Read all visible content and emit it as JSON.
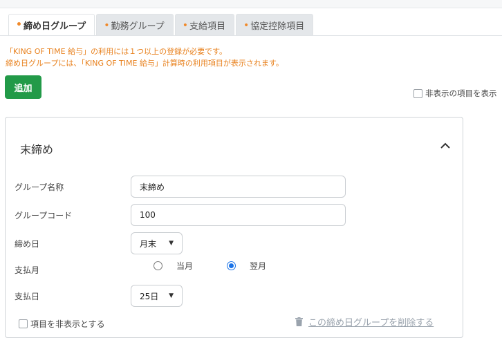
{
  "tabs": [
    {
      "label": "締め日グループ",
      "active": true
    },
    {
      "label": "勤務グループ",
      "active": false
    },
    {
      "label": "支給項目",
      "active": false
    },
    {
      "label": "協定控除項目",
      "active": false
    }
  ],
  "tab_dot": "•",
  "notice": {
    "line1": "「KING OF TIME 給与」の利用には１つ以上の登録が必要です。",
    "line2": "締め日グループには、「KING OF TIME 給与」計算時の利用項目が表示されます。"
  },
  "add_button": "追加",
  "show_hidden_label": "非表示の項目を表示",
  "card": {
    "title": "末締め",
    "fields": {
      "group_name": {
        "label": "グループ名称",
        "value": "末締め"
      },
      "group_code": {
        "label": "グループコード",
        "value": "100"
      },
      "closing_day": {
        "label": "締め日",
        "value": "月末"
      },
      "payment_month": {
        "label": "支払月",
        "options": [
          "当月",
          "翌月"
        ],
        "selected": "翌月"
      },
      "payment_day": {
        "label": "支払日",
        "value": "25日"
      }
    },
    "hide_item_label": "項目を非表示とする",
    "delete_link": "この締め日グループを削除する"
  },
  "colors": {
    "accent_orange": "#f0892a",
    "notice_text": "#e8801c",
    "add_button_bg": "#229a48",
    "radio_selected": "#1a73e8"
  },
  "icons": [
    "chevron-up-icon",
    "trash-icon"
  ]
}
